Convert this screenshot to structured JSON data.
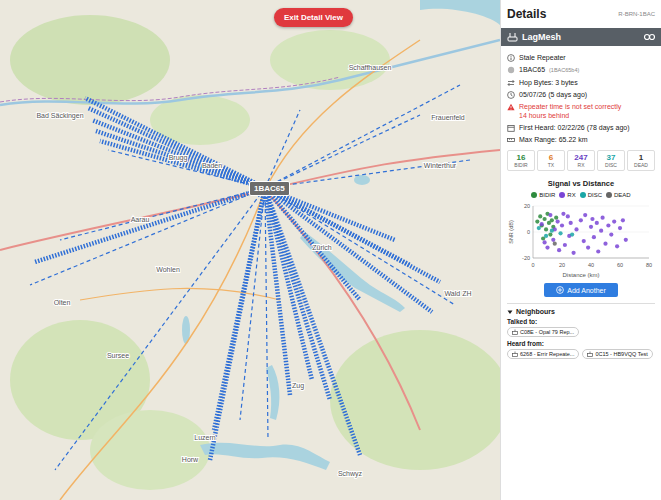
{
  "map": {
    "exit_button": "Exit Detail View",
    "node": "1BAC65",
    "labels": [
      "Schaffhausen",
      "Winterthur",
      "Zürich",
      "Baden",
      "Brugg",
      "Aarau",
      "Olten",
      "Wohlen",
      "Luzern",
      "Zug",
      "Schwyz",
      "Bad Säckingen",
      "Frauenfeld",
      "Wald ZH",
      "Sursee",
      "Horw"
    ]
  },
  "panel": {
    "title": "Details",
    "code": "R-BRN-1BAC",
    "name": "LagMesh",
    "info": [
      {
        "kind": "info",
        "text": "Stale Repeater"
      },
      {
        "kind": "id",
        "text": "1BAC65",
        "sub": "(1BAC65b4)"
      },
      {
        "kind": "hop",
        "text": "Hop Bytes: 3 bytes"
      },
      {
        "kind": "time",
        "text": "05/07/26 (5 days ago)"
      },
      {
        "kind": "warning",
        "text": "Repeater time is not set correctly",
        "sub": "14 hours behind"
      },
      {
        "kind": "calendar",
        "text": "First Heard: 02/22/26 (78 days ago)"
      },
      {
        "kind": "range",
        "text": "Max Range: 65.22 km"
      }
    ],
    "stats": [
      {
        "value": "16",
        "label": "BIDIR",
        "color": "#2e8b3e"
      },
      {
        "value": "6",
        "label": "TX",
        "color": "#e07b2a"
      },
      {
        "value": "247",
        "label": "RX",
        "color": "#6a3fc4"
      },
      {
        "value": "37",
        "label": "DISC",
        "color": "#1aa6a6"
      },
      {
        "value": "1",
        "label": "DEAD",
        "color": "#333333"
      }
    ],
    "chart": {
      "title": "Signal vs Distance",
      "y_label": "SNR (dB)",
      "x_label": "Distance (km)",
      "y_ticks": [
        "20",
        "0",
        "-20"
      ],
      "x_ticks": [
        "0",
        "20",
        "40",
        "60",
        "80"
      ],
      "series": [
        {
          "name": "BIDIR",
          "color": "#2e8b3e",
          "points": [
            [
              3,
              8
            ],
            [
              5,
              12
            ],
            [
              6,
              5
            ],
            [
              8,
              10
            ],
            [
              9,
              2
            ],
            [
              10,
              14
            ],
            [
              11,
              7
            ],
            [
              12,
              -2
            ],
            [
              13,
              9
            ],
            [
              14,
              4
            ],
            [
              7,
              -5
            ],
            [
              16,
              11
            ]
          ]
        },
        {
          "name": "RX",
          "color": "#7a45d6",
          "points": [
            [
              6,
              6
            ],
            [
              8,
              -8
            ],
            [
              10,
              -12
            ],
            [
              12,
              13
            ],
            [
              14,
              -6
            ],
            [
              15,
              2
            ],
            [
              17,
              8
            ],
            [
              18,
              -14
            ],
            [
              20,
              5
            ],
            [
              22,
              -10
            ],
            [
              24,
              12
            ],
            [
              25,
              -3
            ],
            [
              26,
              7
            ],
            [
              28,
              -16
            ],
            [
              30,
              2
            ],
            [
              33,
              9
            ],
            [
              35,
              -7
            ],
            [
              36,
              13
            ],
            [
              38,
              -12
            ],
            [
              40,
              4
            ],
            [
              41,
              10
            ],
            [
              42,
              -4
            ],
            [
              44,
              7
            ],
            [
              45,
              -15
            ],
            [
              47,
              1
            ],
            [
              48,
              11
            ],
            [
              50,
              -9
            ],
            [
              52,
              5
            ],
            [
              54,
              -2
            ],
            [
              56,
              8
            ],
            [
              58,
              -11
            ],
            [
              60,
              3
            ],
            [
              62,
              9
            ],
            [
              64,
              -6
            ],
            [
              21,
              14
            ]
          ]
        },
        {
          "name": "DISC",
          "color": "#1aa6a6",
          "points": [
            [
              4,
              3
            ],
            [
              9,
              -3
            ],
            [
              13,
              1
            ],
            [
              19,
              -1
            ],
            [
              27,
              -2
            ]
          ]
        },
        {
          "name": "DEAD",
          "color": "#666666",
          "points": [
            [
              15,
              -9
            ]
          ]
        }
      ]
    },
    "add_button": "Add Another",
    "neighbours": {
      "title": "Neighbours",
      "expanded": true,
      "groups": [
        {
          "label": "Talked to:",
          "chips": [
            "C08E - Opal 79 Rep..."
          ]
        },
        {
          "label": "Heard from:",
          "chips": [
            "6268 - Errir Repeate...",
            "0C15 - HB9VQQ Test"
          ]
        }
      ]
    }
  }
}
